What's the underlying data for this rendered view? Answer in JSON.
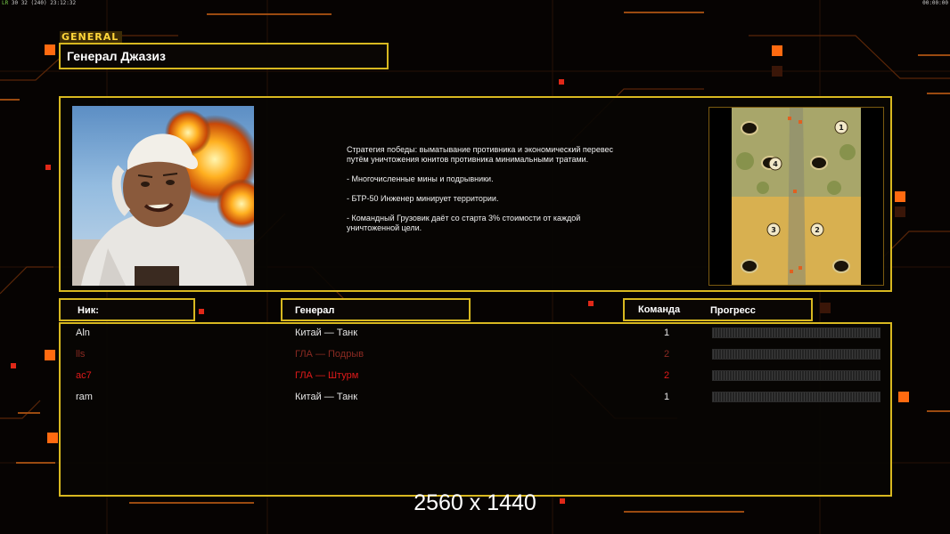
{
  "hud": {
    "left_label": "LR",
    "left_values": "30 32",
    "left_extra": "(240)",
    "time_left": "23:12:32",
    "time_right": "00:00:00"
  },
  "general": {
    "tag": "GENERAL",
    "name": "Генерал Джазиз",
    "strategy": "Стратегия победы: выматывание противника и экономический перевес путём уничтожения юнитов противника минимальными тратами.",
    "features": [
      "- Многочисленные мины и подрывники.",
      "- БТР-50 Инженер минирует территории.",
      "- Командный Грузовик даёт со старта 3% стоимости от каждой уничтоженной цели."
    ]
  },
  "headers": {
    "nick": "Ник:",
    "general": "Генерал",
    "team": "Команда",
    "progress": "Прогресс"
  },
  "players": [
    {
      "nick": "Aln",
      "general": "Китай — Танк",
      "team": "1",
      "color": "#e6e6e6",
      "progress": 0
    },
    {
      "nick": "lls",
      "general": "ГЛА — Подрыв",
      "team": "2",
      "color": "#8a2a22",
      "progress": 0
    },
    {
      "nick": "ac7",
      "general": "ГЛА — Штурм",
      "team": "2",
      "color": "#e01a1a",
      "progress": 0
    },
    {
      "nick": "ram",
      "general": "Китай — Танк",
      "team": "1",
      "color": "#e6e6e6",
      "progress": 0
    }
  ],
  "map": {
    "positions": [
      "1",
      "4",
      "3",
      "2"
    ]
  },
  "resolution": "2560 x 1440",
  "colors": {
    "frame": "#d8b820",
    "accent_orange": "#ff7a10"
  }
}
